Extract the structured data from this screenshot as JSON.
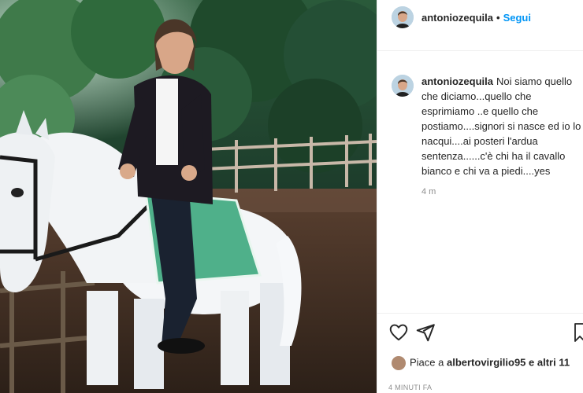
{
  "post": {
    "username": "antoniozequila",
    "follow_label": "Segui",
    "caption": "Noi siamo quello che diciamo...quello che esprimiamo ..e quello che postiamo....signori si nasce ed io lo nacqui....ai posteri l'ardua sentenza......c'è chi ha il cavallo bianco e chi va a piedi....yes",
    "time_short": "4 m",
    "likes_prefix": "Piace a ",
    "likes_user": "albertovirgilio95",
    "likes_suffix": " e altri 11",
    "time_ago": "4 MINUTI FA"
  },
  "icons": {
    "like": "heart-icon",
    "share": "paper-plane-icon",
    "save": "bookmark-icon"
  },
  "colors": {
    "link_blue": "#0095f6",
    "text": "#262626",
    "muted": "#8e8e8e",
    "saddle_cloth": "#4fb08a"
  }
}
